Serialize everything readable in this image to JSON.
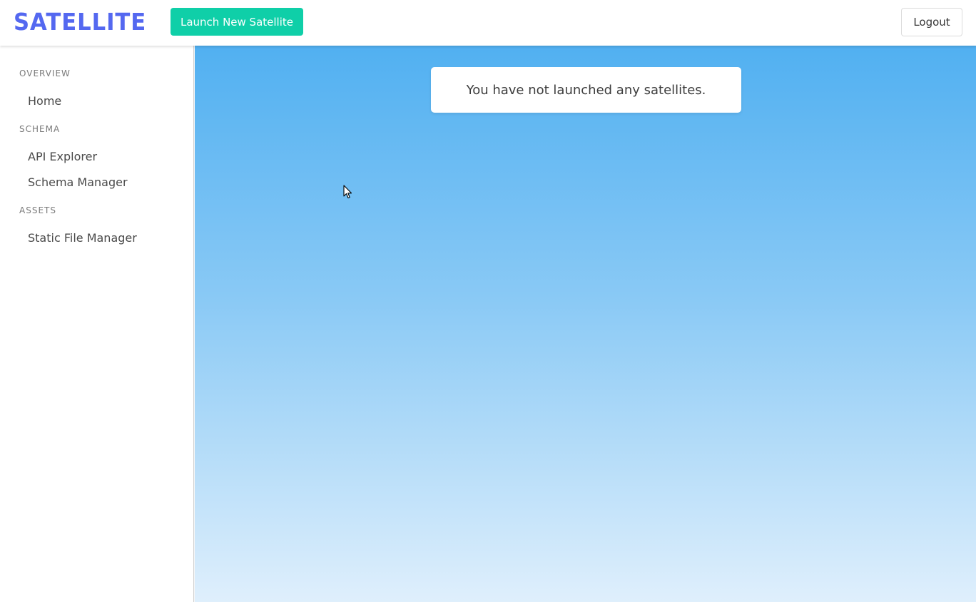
{
  "navbar": {
    "logo": "SATELLITE",
    "launch_label": "Launch New Satellite",
    "logout_label": "Logout"
  },
  "sidebar": {
    "sections": [
      {
        "label": "OVERVIEW",
        "items": [
          {
            "label": "Home"
          }
        ]
      },
      {
        "label": "SCHEMA",
        "items": [
          {
            "label": "API Explorer"
          },
          {
            "label": "Schema Manager"
          }
        ]
      },
      {
        "label": "ASSETS",
        "items": [
          {
            "label": "Static File Manager"
          }
        ]
      }
    ]
  },
  "main": {
    "empty_message": "You have not launched any satellites."
  },
  "colors": {
    "brand": "#5468f0",
    "primary_button": "#0fcfa8",
    "gradient_top": "#51b0f1",
    "gradient_bottom": "#dfeffc"
  },
  "icons": {
    "cursor": "mouse-pointer-icon"
  }
}
